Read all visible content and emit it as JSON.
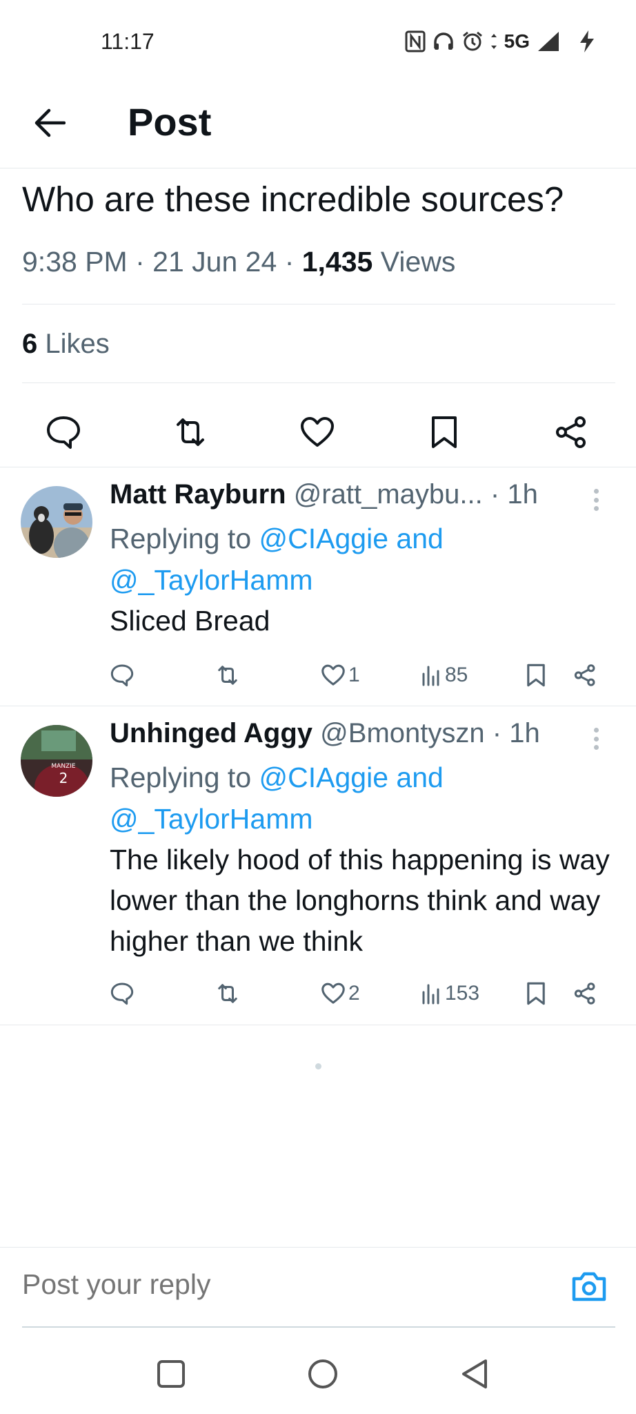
{
  "status_bar": {
    "time": "11:17",
    "network": "5G",
    "icons": [
      "nfc-icon",
      "headphones-icon",
      "alarm-icon",
      "data-arrows-icon",
      "signal-icon",
      "charging-icon"
    ]
  },
  "header": {
    "title": "Post",
    "back_icon": "arrow-left-icon"
  },
  "main_post": {
    "text": "Who are these incredible sources?",
    "time": "9:38 PM",
    "date": "21 Jun 24",
    "separator": "·",
    "views_count": "1,435",
    "views_label": "Views",
    "likes_count": "6",
    "likes_label": "Likes",
    "actions": [
      "reply-icon",
      "repost-icon",
      "like-icon",
      "bookmark-icon",
      "share-icon"
    ]
  },
  "replies": [
    {
      "name": "Matt Rayburn",
      "handle": "@ratt_maybu...",
      "time": "1h",
      "replying_prefix": "Replying to ",
      "replying_to_1": "@CIAggie and",
      "replying_to_2": "@_TaylorHamm",
      "text": "Sliced Bread",
      "likes": "1",
      "views": "85"
    },
    {
      "name": "Unhinged Aggy",
      "handle": "@Bmontyszn",
      "time": "1h",
      "replying_prefix": "Replying to ",
      "replying_to_1": "@CIAggie and",
      "replying_to_2": "@_TaylorHamm",
      "text": "The likely hood of this happening is way lower than the longhorns think and way higher than we think",
      "likes": "2",
      "views": "153"
    }
  ],
  "composer": {
    "placeholder": "Post your reply",
    "camera_icon": "camera-icon"
  },
  "nav_bar": {
    "icons": [
      "recents-square-icon",
      "home-circle-icon",
      "back-triangle-icon"
    ]
  },
  "colors": {
    "accent": "#1d9bf0",
    "text_primary": "#0f1419",
    "text_secondary": "#536471",
    "divider": "#e6e9ec"
  }
}
